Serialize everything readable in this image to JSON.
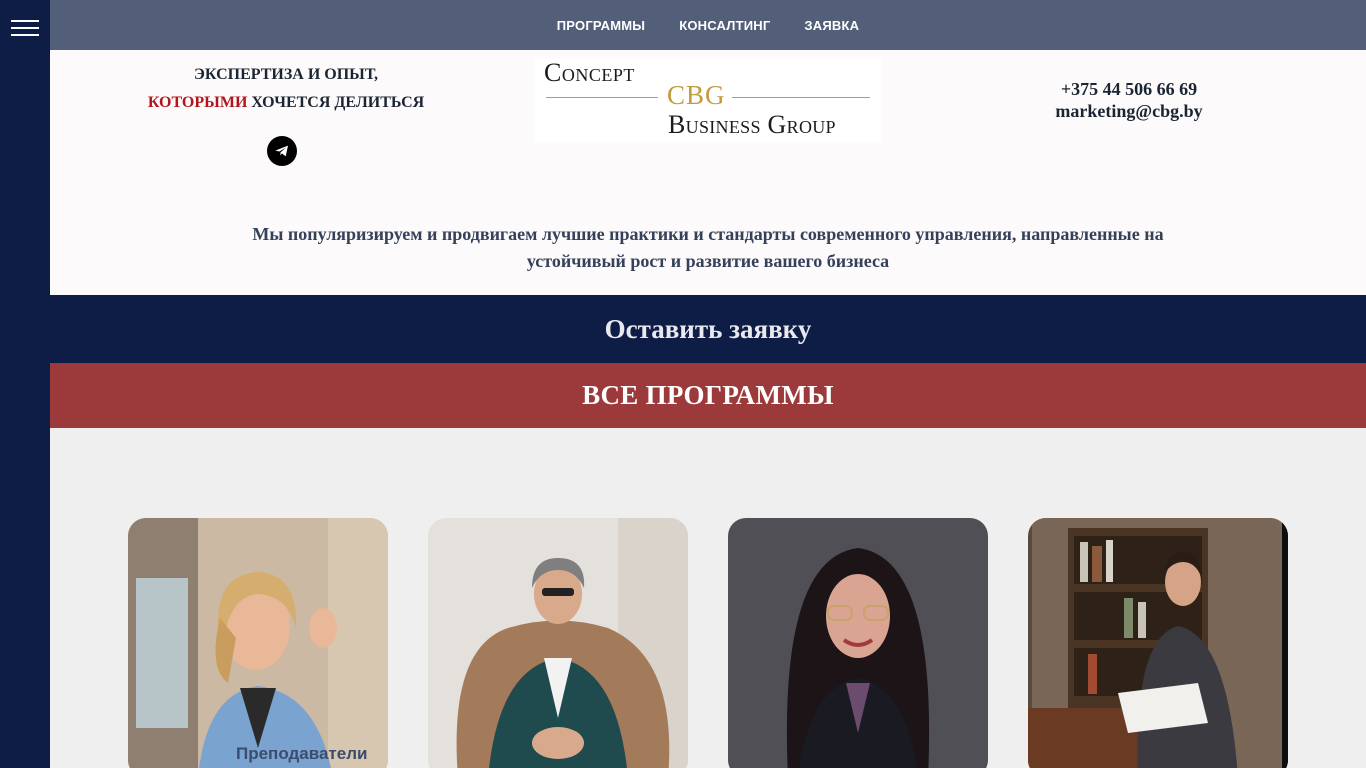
{
  "nav": {
    "items": [
      "ПРОГРАММЫ",
      "КОНСАЛТИНГ",
      "ЗАЯВКА"
    ]
  },
  "header": {
    "tagline_line1": "ЭКСПЕРТИЗА И ОПЫТ,",
    "tagline_accent": "КОТОРЫМИ",
    "tagline_rest": " ХОЧЕТСЯ ДЕЛИТЬСЯ",
    "logo": {
      "line1": "Concept",
      "line2": "CBG",
      "line3": "Business Group"
    },
    "phone": "+375 44 506 66 69",
    "email": "marketing@cbg.by"
  },
  "mission": "Мы популяризируем и продвигаем лучшие практики и стандарты современного управления, направленные на устойчивый рост и развитие вашего бизнеса",
  "request_button": "Оставить заявку",
  "programs_title": "ВСЕ ПРОГРАММЫ",
  "cards": [
    {
      "caption": "Преподаватели"
    }
  ],
  "colors": {
    "sidebar": "#0e1d45",
    "topnav": "#535f78",
    "accent_red": "#b0151b",
    "programs_bar": "#9c393a",
    "logo_gold": "#c49a3a"
  },
  "icons": [
    "menu-icon",
    "telegram-icon"
  ]
}
